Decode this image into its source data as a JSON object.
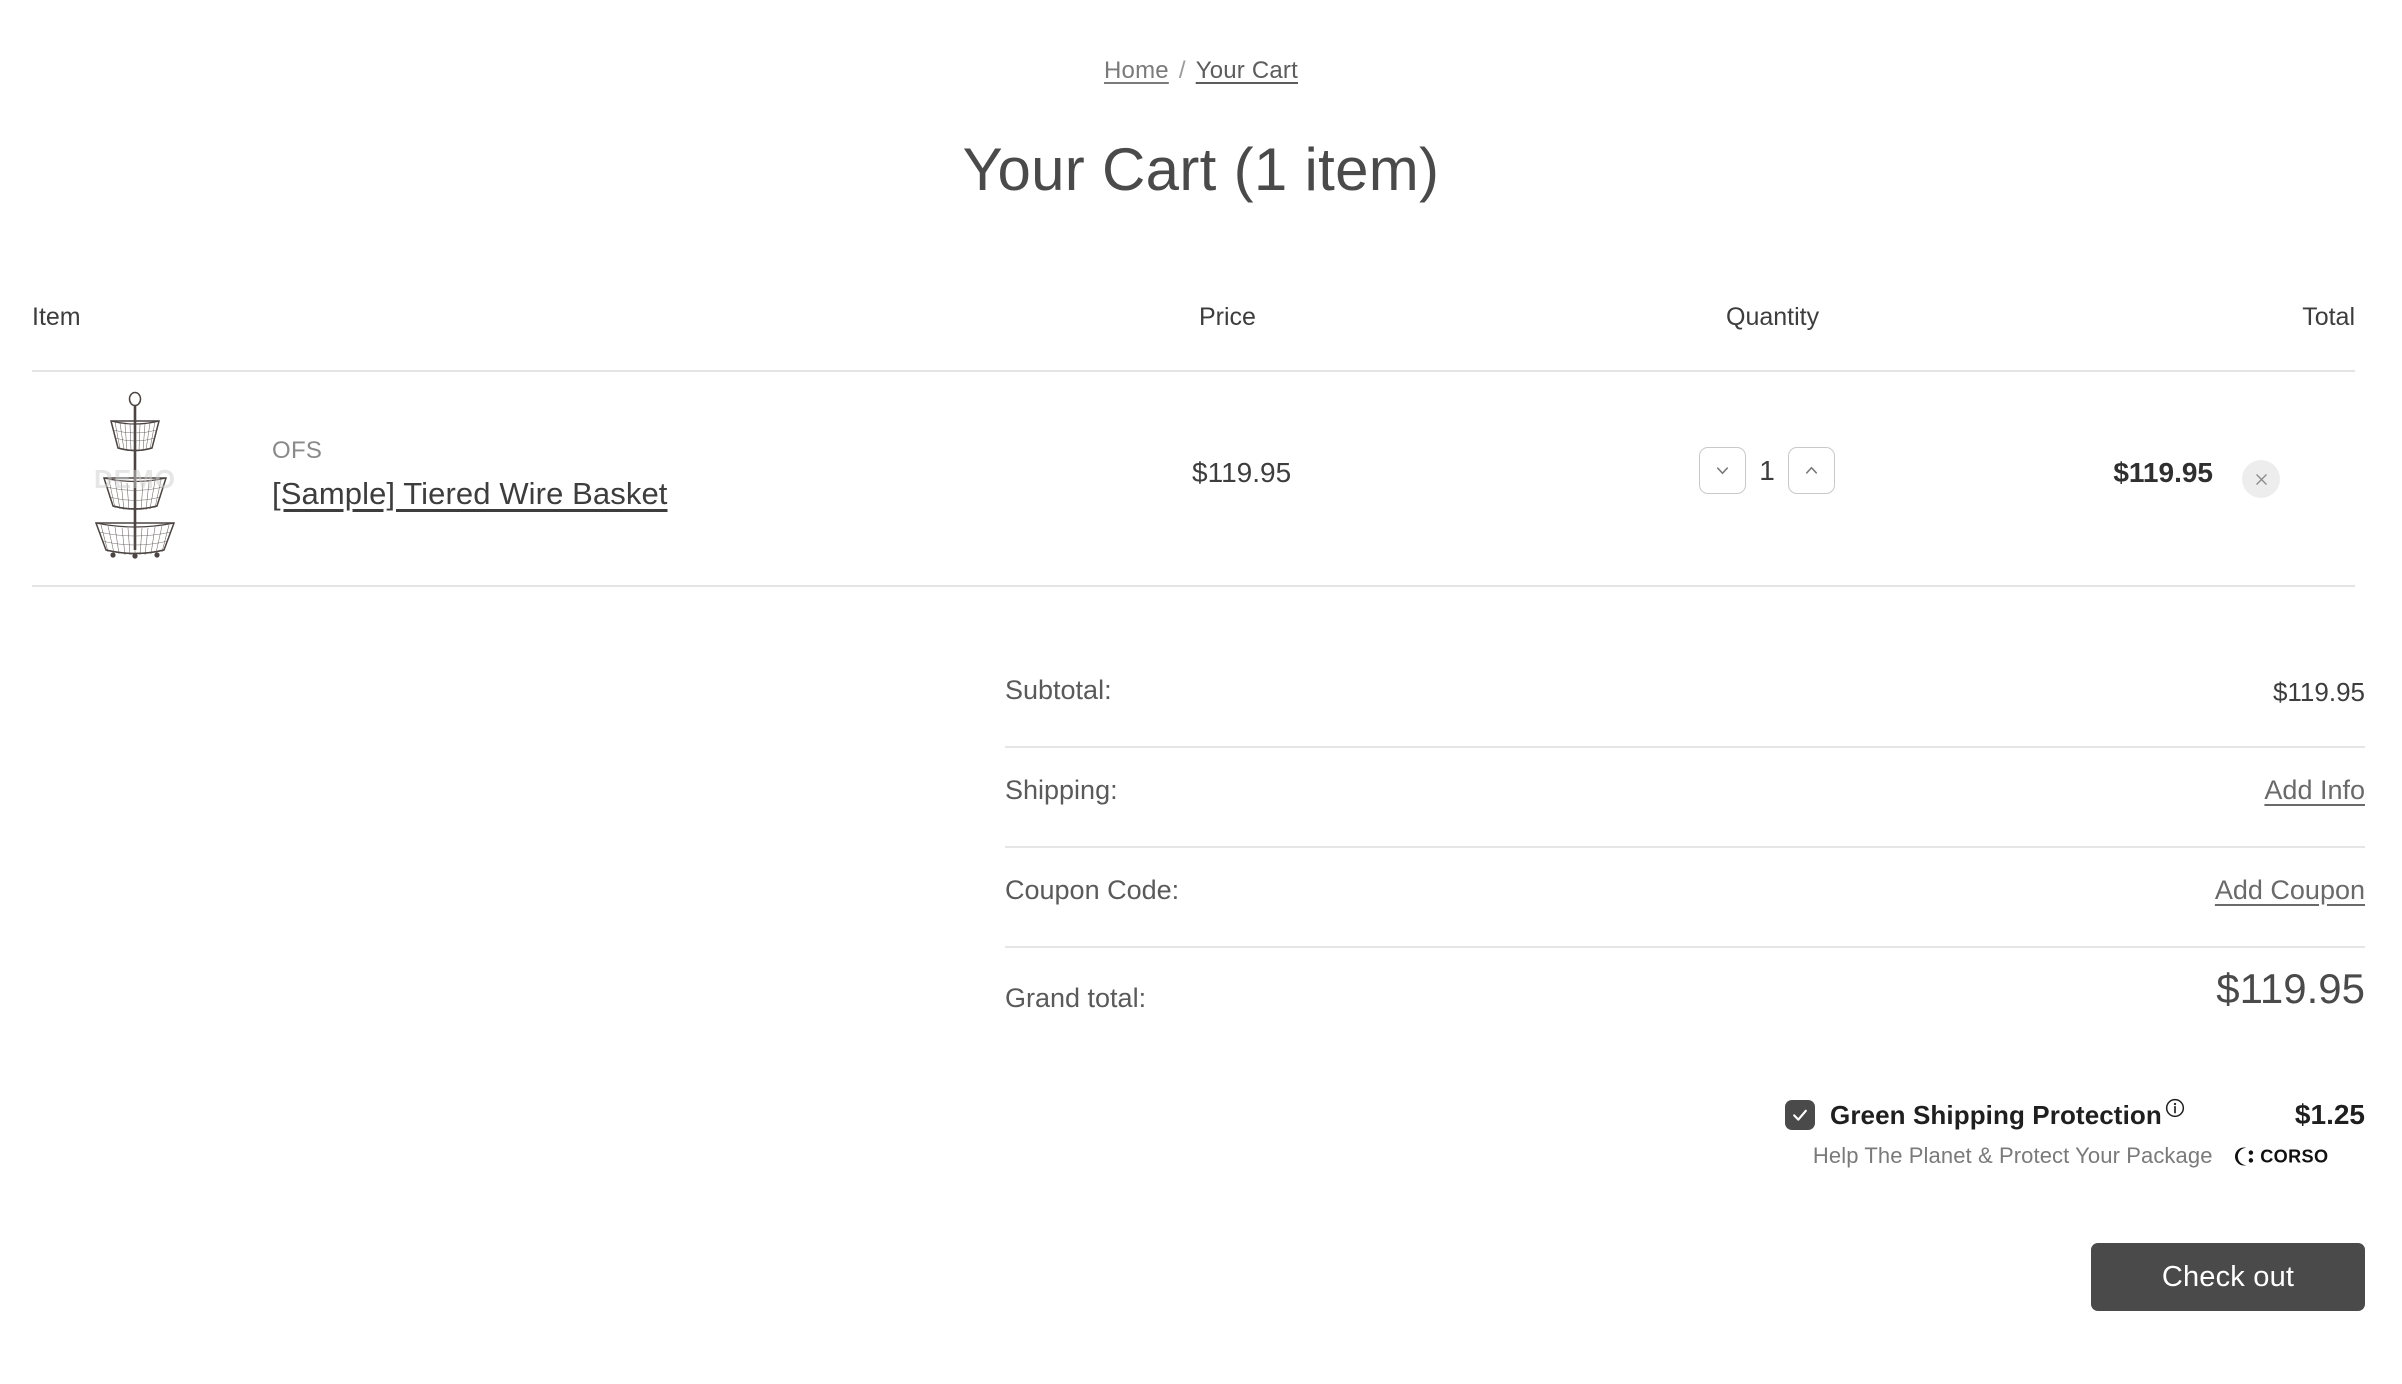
{
  "breadcrumb": {
    "home": "Home",
    "separator": "/",
    "current": "Your Cart"
  },
  "page_title": "Your Cart (1 item)",
  "table": {
    "headers": {
      "item": "Item",
      "price": "Price",
      "quantity": "Quantity",
      "total": "Total"
    },
    "rows": [
      {
        "brand": "OFS",
        "name": "[Sample] Tiered Wire Basket",
        "price": "$119.95",
        "quantity": "1",
        "total": "$119.95",
        "image_alt": "tiered-wire-basket-thumbnail",
        "image_watermark": "DEMO",
        "decrease_label": "chevron-down-icon",
        "increase_label": "chevron-up-icon",
        "remove_label": "close-icon"
      }
    ]
  },
  "summary": {
    "subtotal_label": "Subtotal:",
    "subtotal_value": "$119.95",
    "shipping_label": "Shipping:",
    "shipping_link": "Add Info",
    "coupon_label": "Coupon Code:",
    "coupon_link": "Add Coupon",
    "grand_label": "Grand total:",
    "grand_value": "$119.95"
  },
  "protection": {
    "title": "Green Shipping Protection",
    "price": "$1.25",
    "subtitle": "Help The Planet & Protect Your Package",
    "brand": "CORSO",
    "checked": true,
    "info_icon": "info-circle-icon"
  },
  "checkout": {
    "label": "Check out"
  },
  "colors": {
    "button_dark": "#4a4a4a",
    "text_primary": "#3d3d3d",
    "text_muted": "#7a7a7a",
    "divider": "#e4e4e4",
    "remove_bg": "#ededed"
  }
}
